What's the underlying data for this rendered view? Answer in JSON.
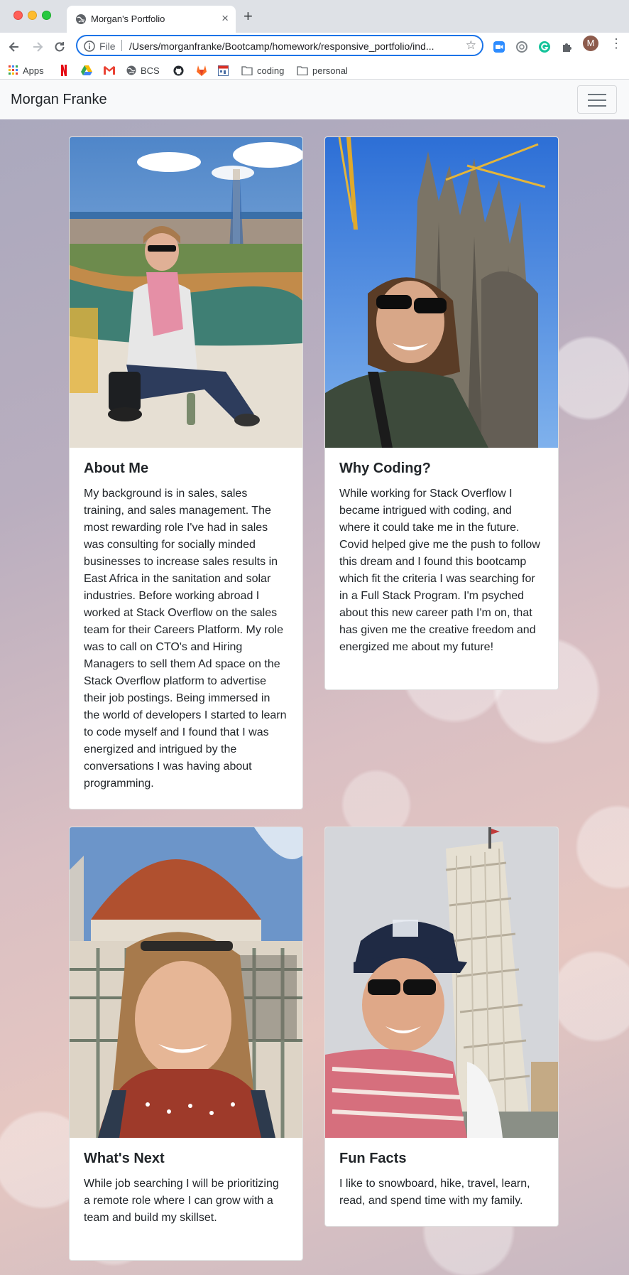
{
  "browser": {
    "tab_title": "Morgan's Portfolio",
    "url_scheme": "File",
    "url": "/Users/morganfranke/Bootcamp/homework/responsive_portfolio/ind...",
    "profile_initial": "M",
    "bookmarks": [
      {
        "label": "Apps",
        "icon": "apps-grid-icon"
      },
      {
        "label": "",
        "icon": "netflix-icon"
      },
      {
        "label": "",
        "icon": "google-drive-icon"
      },
      {
        "label": "",
        "icon": "gmail-icon"
      },
      {
        "label": "BCS",
        "icon": "globe-icon"
      },
      {
        "label": "",
        "icon": "github-icon"
      },
      {
        "label": "",
        "icon": "gitlab-icon"
      },
      {
        "label": "",
        "icon": "calendar-icon"
      },
      {
        "label": "coding",
        "icon": "folder-icon"
      },
      {
        "label": "personal",
        "icon": "folder-icon"
      }
    ]
  },
  "navbar": {
    "brand": "Morgan Franke"
  },
  "cards": [
    {
      "title": "About Me",
      "text": "My background is in sales, sales training, and sales management. The most rewarding role I've had in sales was consulting for socially minded businesses to increase sales results in East Africa in the sanitation and solar industries. Before working abroad I worked at Stack Overflow on the sales team for their Careers Platform. My role was to call on CTO's and Hiring Managers to sell them Ad space on the Stack Overflow platform to advertise their job postings. Being immersed in the world of developers I started to learn to code myself and I found that I was energized and intrigued by the conversations I was having about programming."
    },
    {
      "title": "Why Coding?",
      "text": "While working for Stack Overflow I became intrigued with coding, and where it could take me in the future. Covid helped give me the push to follow this dream and I found this bootcamp which fit the criteria I was searching for in a Full Stack Program. I'm psyched about this new career path I'm on, that has given me the creative freedom and energized me about my future!"
    },
    {
      "title": "What's Next",
      "text": "While job searching I will be prioritizing a remote role where I can grow with a team and build my skillset."
    },
    {
      "title": "Fun Facts",
      "text": "I like to snowboard, hike, travel, learn, read, and spend time with my family."
    }
  ]
}
